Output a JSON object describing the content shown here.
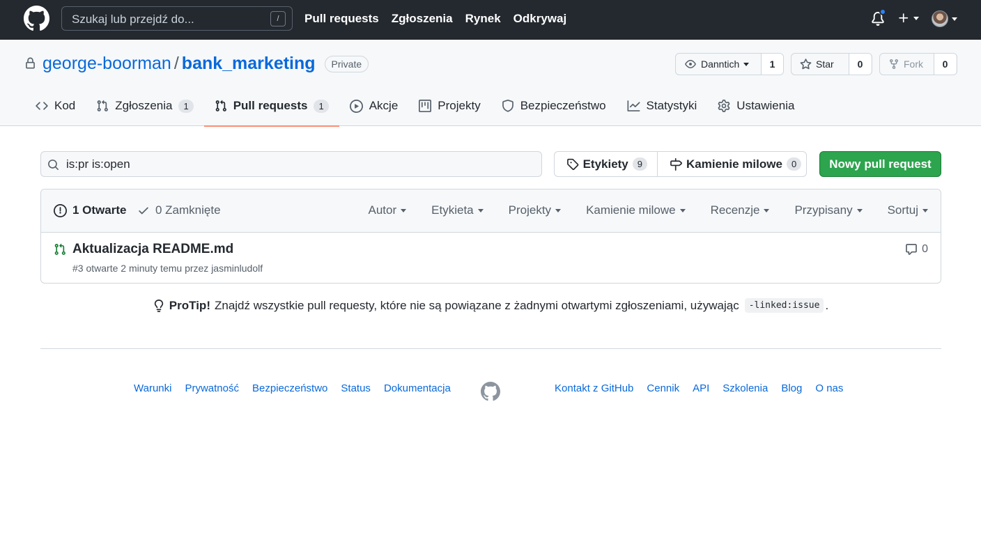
{
  "header": {
    "search_placeholder": "Szukaj lub przejdź do...",
    "search_shortcut": "/",
    "nav": [
      {
        "label": "Pull requests"
      },
      {
        "label": "Zgłoszenia"
      },
      {
        "label": "Rynek"
      },
      {
        "label": "Odkrywaj"
      }
    ]
  },
  "repo": {
    "owner": "george-boorman",
    "separator": "/",
    "name": "bank_marketing",
    "visibility": "Private",
    "watch_label": "Danntich",
    "watch_count": "1",
    "star_label": "Star",
    "star_count": "0",
    "fork_label": "Fork",
    "fork_count": "0"
  },
  "tabs": [
    {
      "label": "Kod",
      "count": null,
      "icon": "code-icon"
    },
    {
      "label": "Zgłoszenia",
      "count": "1",
      "icon": "issue-icon"
    },
    {
      "label": "Pull requests",
      "count": "1",
      "icon": "pull-request-icon",
      "active": true
    },
    {
      "label": "Akcje",
      "count": null,
      "icon": "play-icon"
    },
    {
      "label": "Projekty",
      "count": null,
      "icon": "project-icon"
    },
    {
      "label": "Bezpieczeństwo",
      "count": null,
      "icon": "shield-icon"
    },
    {
      "label": "Statystyki",
      "count": null,
      "icon": "graph-icon"
    },
    {
      "label": "Ustawienia",
      "count": null,
      "icon": "gear-icon"
    }
  ],
  "toolbar": {
    "filter_value": "is:pr is:open",
    "labels_label": "Etykiety",
    "labels_count": "9",
    "milestones_label": "Kamienie milowe",
    "milestones_count": "0",
    "new_pr_label": "Nowy pull request"
  },
  "list": {
    "open_label": "1 Otwarte",
    "closed_label": "0 Zamknięte",
    "menus": [
      {
        "label": "Autor"
      },
      {
        "label": "Etykieta"
      },
      {
        "label": "Projekty"
      },
      {
        "label": "Kamienie milowe"
      },
      {
        "label": "Recenzje"
      },
      {
        "label": "Przypisany"
      },
      {
        "label": "Sortuj"
      }
    ],
    "items": [
      {
        "title": "Aktualizacja README.md",
        "meta": "#3 otwarte 2 minuty temu przez jasminludolf",
        "comments": "0"
      }
    ]
  },
  "protip": {
    "strong": "ProTip!",
    "text": "Znajdź wszystkie pull requesty, które nie są powiązane z żadnymi otwartymi zgłoszeniami, używając",
    "code": "-linked:issue",
    "end": "."
  },
  "footer": {
    "left": [
      {
        "label": "Warunki"
      },
      {
        "label": "Prywatność"
      },
      {
        "label": "Bezpieczeństwo"
      },
      {
        "label": "Status"
      },
      {
        "label": "Dokumentacja"
      }
    ],
    "right": [
      {
        "label": "Kontakt z GitHub"
      },
      {
        "label": "Cennik"
      },
      {
        "label": "API"
      },
      {
        "label": "Szkolenia"
      },
      {
        "label": "Blog"
      },
      {
        "label": "O nas"
      }
    ]
  },
  "colors": {
    "header_bg": "#24292f",
    "link": "#0969da",
    "primary_button": "#2da44e",
    "open_state": "#1a7f37",
    "active_tab_underline": "#fd8c73"
  }
}
